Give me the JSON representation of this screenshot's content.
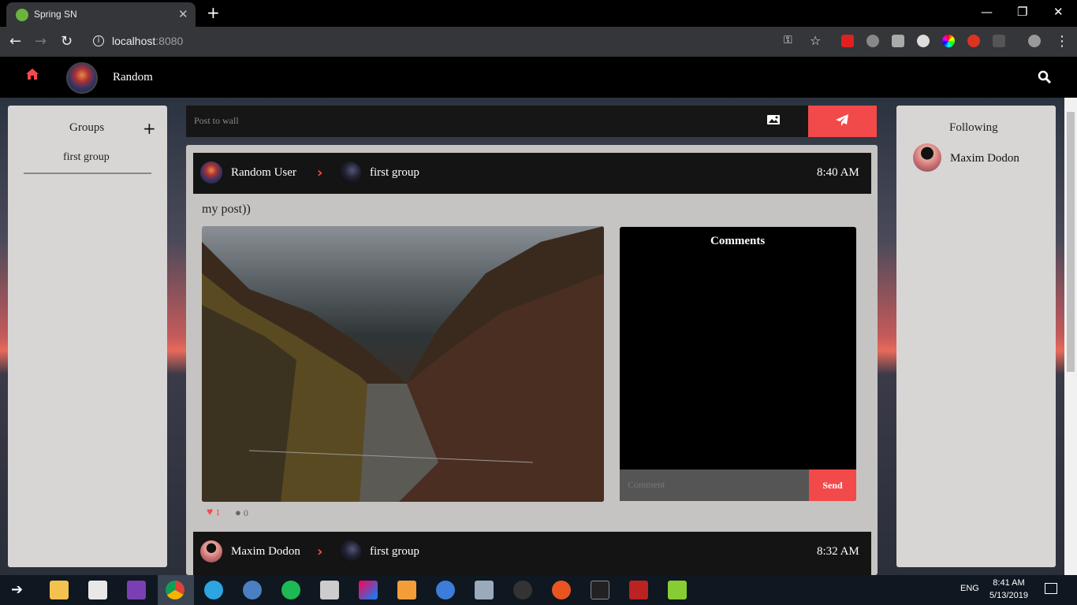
{
  "browser": {
    "tab_title": "Spring SN",
    "tab_close": "✕",
    "new_tab": "+",
    "url_host": "localhost",
    "url_port": ":8080",
    "win_min": "—",
    "win_max": "❐",
    "win_close": "✕"
  },
  "navbar": {
    "username": "Random"
  },
  "groups": {
    "title": "Groups",
    "add": "+",
    "items": [
      "first group"
    ]
  },
  "following": {
    "title": "Following",
    "items": [
      "Maxim Dodon"
    ]
  },
  "postbar": {
    "placeholder": "Post to wall"
  },
  "posts": [
    {
      "author": "Random User",
      "group": "first group",
      "time": "8:40 AM",
      "text": "my post))",
      "likes": "1",
      "comments": "0",
      "comments_title": "Comments",
      "comment_placeholder": "Comment",
      "send_label": "Send"
    },
    {
      "author": "Maxim Dodon",
      "group": "first group",
      "time": "8:32 AM"
    }
  ],
  "taskbar": {
    "lang": "ENG",
    "time": "8:41 AM",
    "date": "5/13/2019"
  },
  "colors": {
    "accent": "#f24a4a",
    "panel": "#d8d6d4",
    "dark": "#141414"
  }
}
